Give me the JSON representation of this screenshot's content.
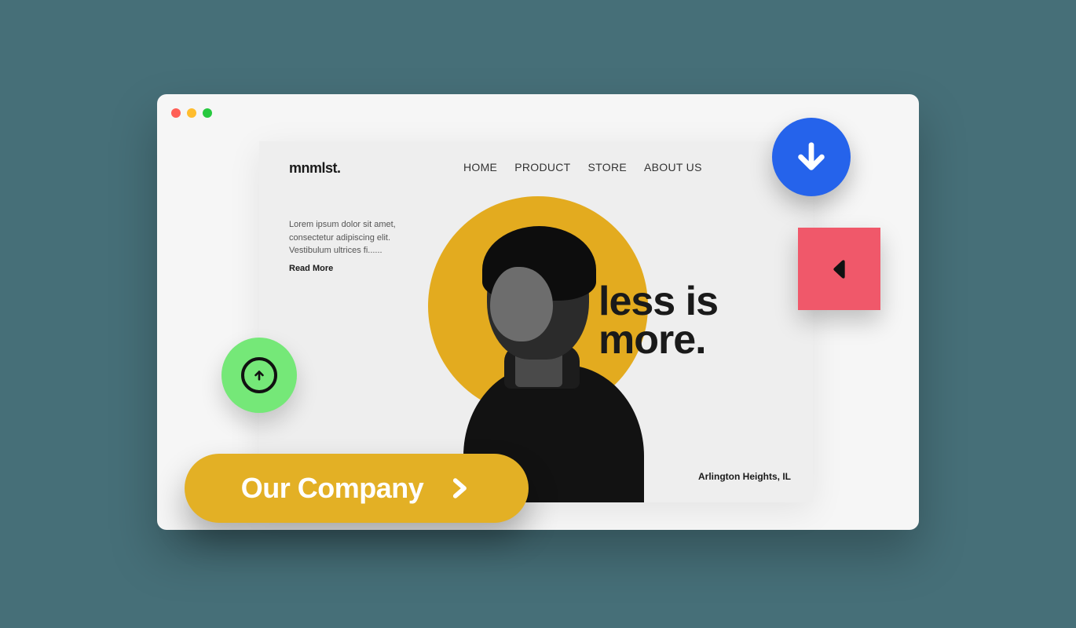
{
  "page": {
    "brand": "mnmlst.",
    "nav": [
      "HOME",
      "PRODUCT",
      "STORE",
      "ABOUT US"
    ],
    "blurb": "Lorem ipsum dolor sit amet, consectetur adipiscing elit. Vestibulum ultrices fi......",
    "read_more": "Read More",
    "headline_line1": "less is",
    "headline_line2": "more.",
    "location": "Arlington Heights, IL"
  },
  "cta": {
    "label": "Our Company"
  },
  "colors": {
    "accent_yellow": "#e3ab1f",
    "green": "#75e878",
    "blue": "#2563eb",
    "red": "#f0586a"
  }
}
